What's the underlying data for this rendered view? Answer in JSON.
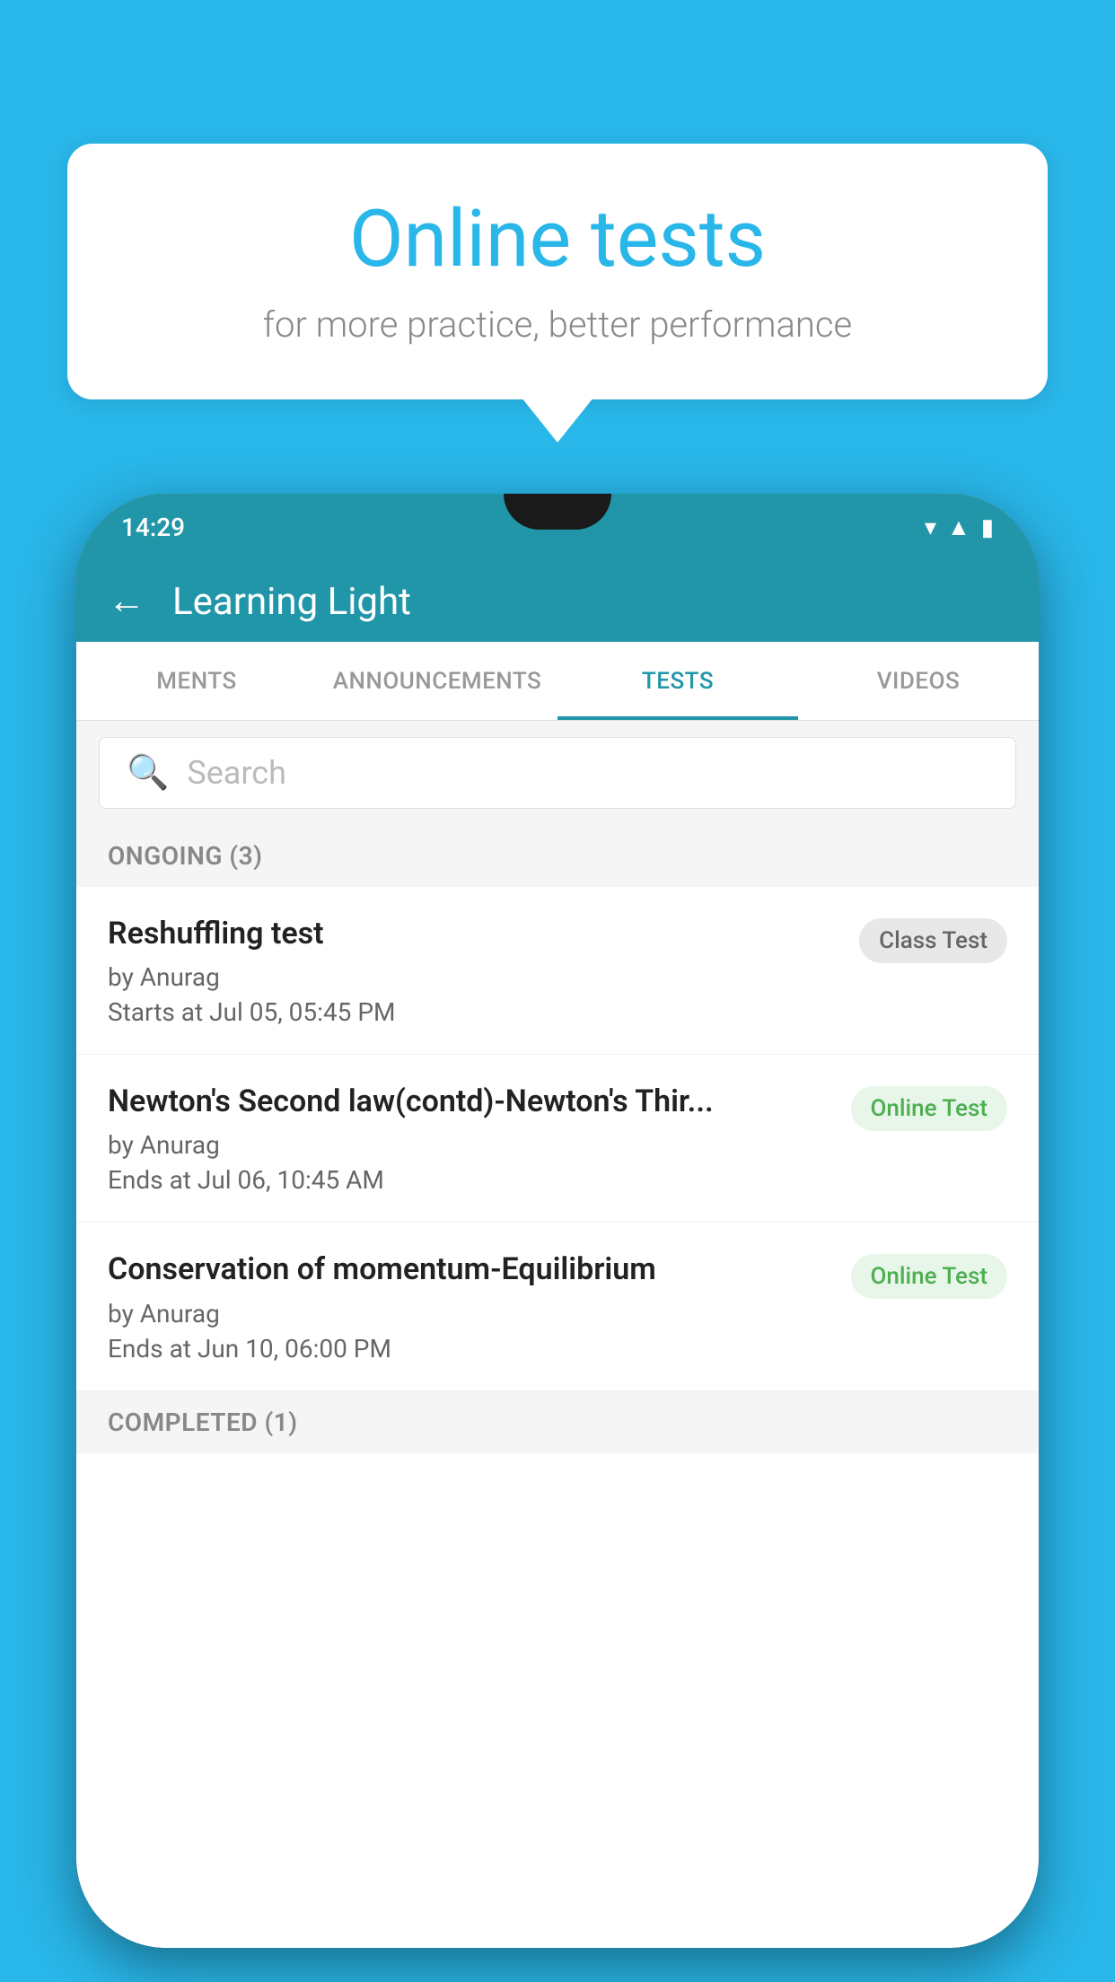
{
  "background": {
    "color": "#29b6e8"
  },
  "bubble": {
    "title": "Online tests",
    "subtitle": "for more practice, better performance"
  },
  "phone": {
    "status": {
      "time": "14:29",
      "icons": [
        "wifi",
        "signal",
        "battery"
      ]
    },
    "header": {
      "back_label": "←",
      "title": "Learning Light"
    },
    "tabs": [
      {
        "label": "MENTS",
        "active": false
      },
      {
        "label": "ANNOUNCEMENTS",
        "active": false
      },
      {
        "label": "TESTS",
        "active": true
      },
      {
        "label": "VIDEOS",
        "active": false
      }
    ],
    "search": {
      "placeholder": "Search"
    },
    "ongoing_section": {
      "label": "ONGOING (3)"
    },
    "tests": [
      {
        "name": "Reshuffling test",
        "author": "by Anurag",
        "date": "Starts at  Jul 05, 05:45 PM",
        "badge": "Class Test",
        "badge_type": "class"
      },
      {
        "name": "Newton's Second law(contd)-Newton's Thir...",
        "author": "by Anurag",
        "date": "Ends at  Jul 06, 10:45 AM",
        "badge": "Online Test",
        "badge_type": "online"
      },
      {
        "name": "Conservation of momentum-Equilibrium",
        "author": "by Anurag",
        "date": "Ends at  Jun 10, 06:00 PM",
        "badge": "Online Test",
        "badge_type": "online"
      }
    ],
    "completed_section": {
      "label": "COMPLETED (1)"
    }
  }
}
